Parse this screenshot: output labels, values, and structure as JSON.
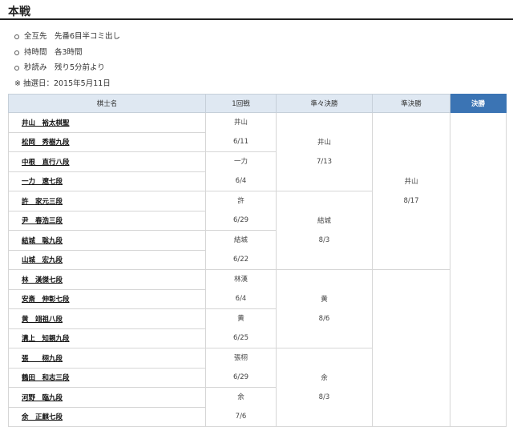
{
  "section_title": "本戦",
  "rules": [
    "全互先　先番6目半コミ出し",
    "持時間　各3時間",
    "秒読み　残り5分前より"
  ],
  "lottery_note": "※ 抽選日：2015年5月11日",
  "headers": {
    "players": "棋士名",
    "round1": "1回戦",
    "quarterfinal": "準々決勝",
    "semifinal": "準決勝",
    "final": "決勝"
  },
  "players": [
    "井山　裕太棋聖",
    "松岡　秀樹九段",
    "中根　直行八段",
    "一力　遼七段",
    "許　家元三段",
    "尹　春浩三段",
    "結城　聡九段",
    "山城　宏九段",
    "林　漢傑七段",
    "安斎　伸彰七段",
    "黄　翊祖八段",
    "溝上　知親九段",
    "張　　栩九段",
    "鶴田　和志三段",
    "河野　臨九段",
    "余　正麒七段"
  ],
  "round1": [
    {
      "winner": "井山",
      "date": "6/11"
    },
    {
      "winner": "一力",
      "date": "6/4"
    },
    {
      "winner": "許",
      "date": "6/29"
    },
    {
      "winner": "結城",
      "date": "6/22"
    },
    {
      "winner": "林漢",
      "date": "6/4"
    },
    {
      "winner": "黄",
      "date": "6/25"
    },
    {
      "winner": "張栩",
      "date": "6/29"
    },
    {
      "winner": "余",
      "date": "7/6"
    }
  ],
  "quarterfinal": [
    {
      "winner": "井山",
      "date": "7/13"
    },
    {
      "winner": "結城",
      "date": "8/3"
    },
    {
      "winner": "黄",
      "date": "8/6"
    },
    {
      "winner": "余",
      "date": "8/3"
    }
  ],
  "semifinal": [
    {
      "winner": "井山",
      "date": "8/17"
    },
    {
      "winner": "",
      "date": ""
    }
  ],
  "final": {
    "winner": "",
    "date": ""
  }
}
